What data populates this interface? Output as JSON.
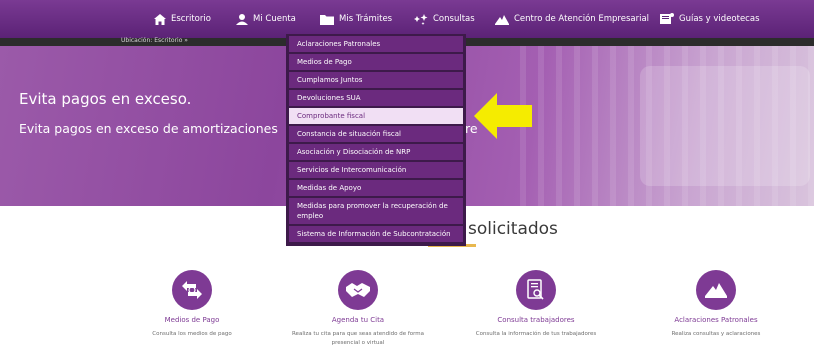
{
  "nav": {
    "items": [
      {
        "label": "Escritorio",
        "icon": "home-icon"
      },
      {
        "label": "Mi Cuenta",
        "icon": "user-icon"
      },
      {
        "label": "Mis Trámites",
        "icon": "folder-icon"
      },
      {
        "label": "Consultas",
        "icon": "sparkle-icon"
      },
      {
        "label": "Centro de Atención Empresarial",
        "icon": "mountain-logo-icon"
      },
      {
        "label": "Guías y videotecas",
        "icon": "book-icon"
      }
    ]
  },
  "breadcrumb": "Ubicación: Escritorio »",
  "hero": {
    "title": "Evita pagos en exceso.",
    "subtitle": "Evita pagos en exceso de amortizaciones",
    "subtitle_tail": "re"
  },
  "dropdown": {
    "items": [
      "Aclaraciones Patronales",
      "Medios de Pago",
      "Cumplamos Juntos",
      "Devoluciones SUA",
      "Comprobante fiscal",
      "Constancia de situación fiscal",
      "Asociación y Disociación de NRP",
      "Servicios de Intercomunicación",
      "Medidas de Apoyo",
      "Medidas para promover la recuperación de empleo",
      "Sistema de Información de Subcontratación"
    ],
    "active_index": 4
  },
  "section": {
    "title": "solicitados"
  },
  "tiles": [
    {
      "title": "Medios de Pago",
      "desc": "Consulta los medios de pago",
      "icon": "payment-exchange-icon"
    },
    {
      "title": "Agenda tu Cita",
      "desc": "Realiza tu cita para que seas atendido de forma presencial o virtual",
      "icon": "handshake-icon"
    },
    {
      "title": "Consulta trabajadores",
      "desc": "Consulta la información de tus trabajadores",
      "icon": "document-search-icon"
    },
    {
      "title": "Aclaraciones Patronales",
      "desc": "Realiza consultas y aclaraciones",
      "icon": "mountain-logo-icon"
    }
  ],
  "colors": {
    "brand": "#6b2a7e",
    "accent": "#e8b84f",
    "arrow": "#f5ec00"
  }
}
